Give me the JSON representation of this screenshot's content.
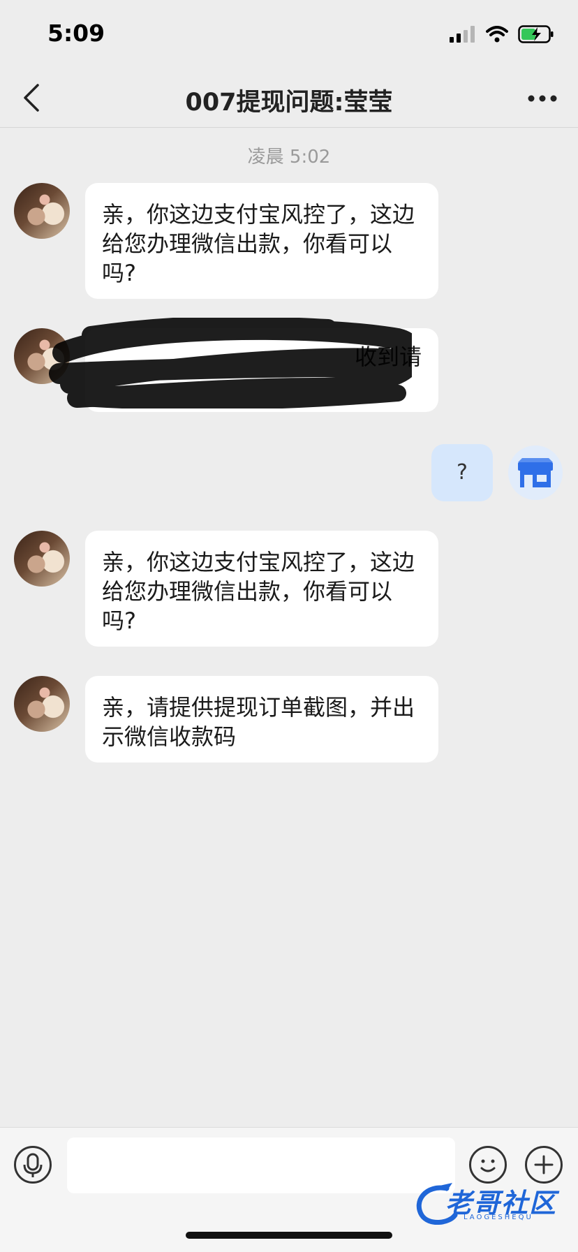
{
  "status_bar": {
    "time": "5:09"
  },
  "nav": {
    "title": "007提现问题:莹莹"
  },
  "timestamp": "凌晨 5:02",
  "messages": [
    {
      "text": "亲，你这边支付宝风控了，这边给您办理微信出款，你看可以吗?"
    },
    {
      "text": "收到请"
    },
    {
      "text": "?"
    },
    {
      "text": "亲，你这边支付宝风控了，这边给您办理微信出款，你看可以吗?"
    },
    {
      "text": "亲，请提供提现订单截图，并出示微信收款码"
    }
  ],
  "input": {
    "placeholder": ""
  },
  "watermark": {
    "main": "老哥社区",
    "sub": "LAOGESHEQU"
  }
}
